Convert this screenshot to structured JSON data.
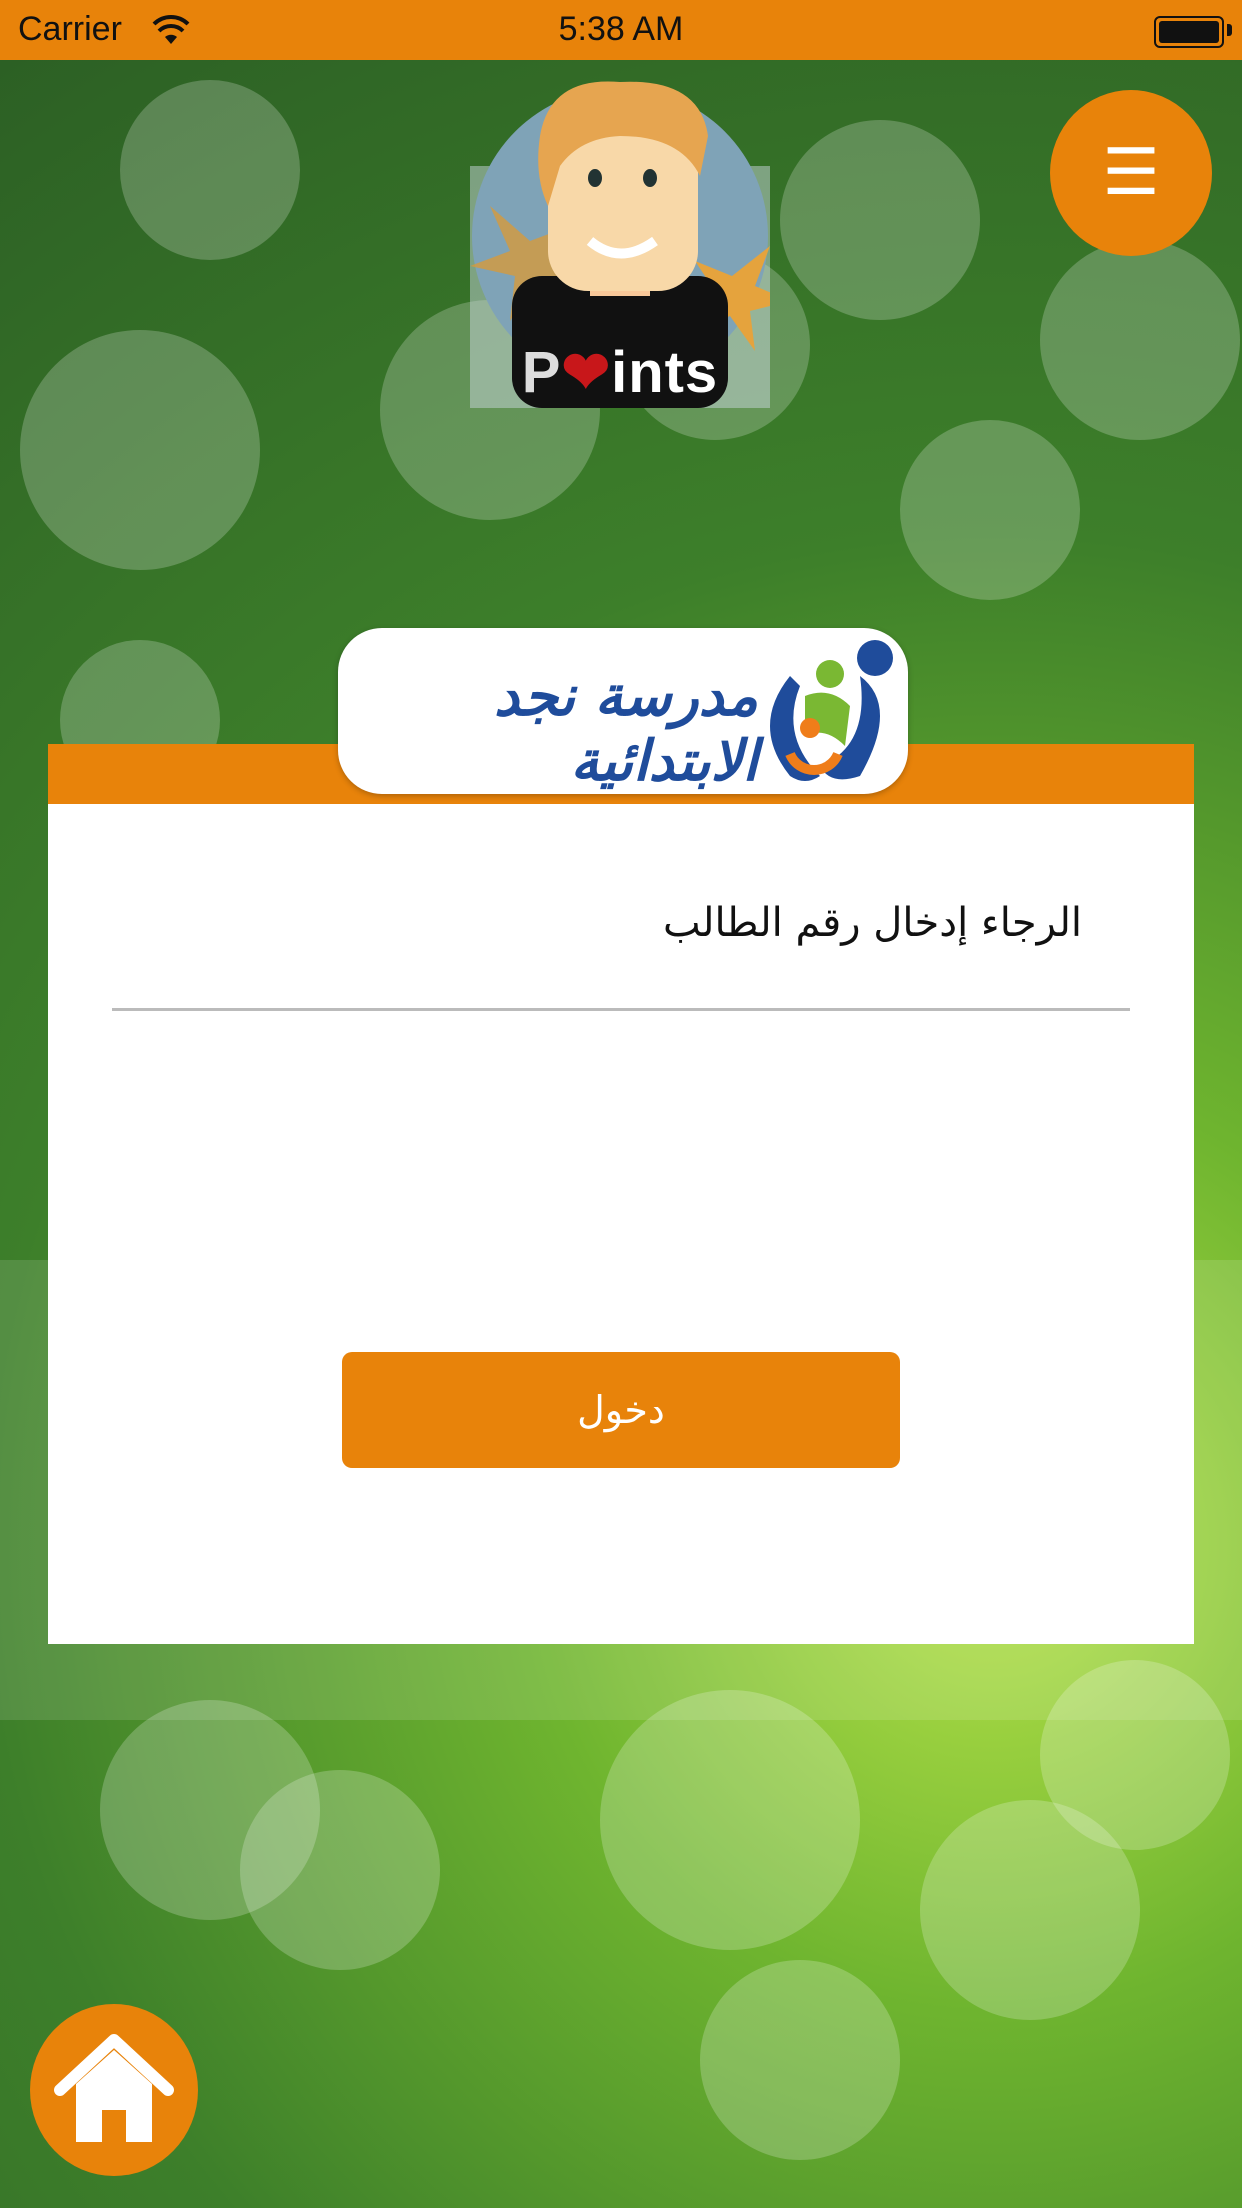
{
  "status_bar": {
    "carrier": "Carrier",
    "time": "5:38 AM",
    "wifi_icon": "wifi-icon",
    "battery_icon": "battery-icon"
  },
  "header": {
    "menu_icon": "☰",
    "app_logo_text": {
      "prefix": "P",
      "suffix": "ints"
    }
  },
  "school": {
    "name": "مدرسة نجد الابتدائية",
    "logo_icon": "family-logo-icon"
  },
  "form": {
    "student_id_label": "الرجاء إدخال رقم الطالب",
    "student_id_value": "",
    "submit_label": "دخول"
  },
  "footer": {
    "home_icon": "home-icon"
  },
  "colors": {
    "accent": "#e8830a",
    "school_blue": "#1f4c9b",
    "card_bg": "#ffffff"
  }
}
